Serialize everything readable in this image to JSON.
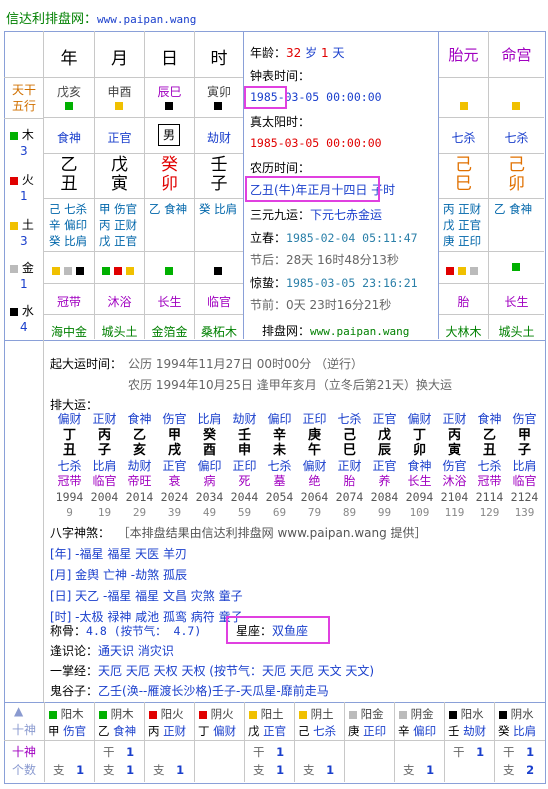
{
  "header": {
    "title": "信达利排盘网：",
    "url": "www.paipan.wang"
  },
  "pillars": {
    "labels": [
      "年",
      "月",
      "日",
      "时"
    ],
    "left_labels": {
      "stem": "天干",
      "element": "五行"
    },
    "nayin_short": [
      "戊亥",
      "申酉",
      "辰巳",
      "寅卯"
    ],
    "gods": [
      "食神",
      "正官",
      "男",
      "劫财"
    ],
    "stems": [
      "乙",
      "戊",
      "癸",
      "壬"
    ],
    "branches": [
      "丑",
      "寅",
      "卯",
      "子"
    ],
    "hidden": [
      [
        "己 七杀",
        "辛 偏印",
        "癸 比肩"
      ],
      [
        "甲 伤官",
        "丙 正财",
        "戊 正官"
      ],
      [
        "乙 食神"
      ],
      [
        "癸 比肩"
      ]
    ],
    "growth": [
      "冠带",
      "沐浴",
      "长生",
      "临官"
    ],
    "nayin": [
      "海中金",
      "城头土",
      "金箔金",
      "桑柘木"
    ]
  },
  "elements": [
    {
      "name": "木",
      "count": "3",
      "color": "#00b000"
    },
    {
      "name": "火",
      "count": "1",
      "color": "#e00000"
    },
    {
      "name": "土",
      "count": "3",
      "color": "#f0c000"
    },
    {
      "name": "金",
      "count": "1",
      "color": "#bbbbbb"
    },
    {
      "name": "水",
      "count": "4",
      "color": "#000000"
    }
  ],
  "info": {
    "age_label": "年龄：",
    "age_years": "32",
    "age_unit": "岁",
    "age_days": "1",
    "age_days_unit": "天",
    "clock_label": "钟表时间：",
    "clock_value": "1985-03-05 00:00:00",
    "solar_label": "真太阳时：",
    "solar_value": "1985-03-05 00:00:00",
    "lunar_label": "农历时间：",
    "lunar_value": "乙丑(牛)年正月十四日 子时",
    "yuan_label": "三元九运：",
    "yuan_value": "下元七赤金运",
    "lichun_label": "立春：",
    "lichun_value": "1985-02-04 05:11:47",
    "after_label": "节后：",
    "after_value": "28天 16时48分13秒",
    "jingzhe_label": "惊蛰：",
    "jingzhe_value": "1985-03-05 23:16:21",
    "before_label": "节前：",
    "before_value": "0天 23时16分21秒",
    "site_label": "排盘网：",
    "site_value": "www.paipan.wang"
  },
  "right_cols": {
    "labels": [
      "胎元",
      "命宫"
    ],
    "gods": [
      "七杀",
      "七杀"
    ],
    "stems": [
      "己",
      "己"
    ],
    "branches": [
      "巳",
      "卯"
    ],
    "hidden": [
      [
        "丙 正财",
        "戊 正官",
        "庚 正印"
      ],
      [
        "乙 食神"
      ]
    ],
    "growth": [
      "胎",
      "长生"
    ],
    "nayin": [
      "大林木",
      "城头土"
    ]
  },
  "luck": {
    "start_label": "起大运时间：",
    "start_solar": "公历 1994年11月27日 00时00分 （逆行）",
    "start_lunar": "农历 1994年10月25日 逢甲年亥月（立冬后第21天）换大运",
    "list_label": "排大运：",
    "gods": [
      "偏财",
      "正财",
      "食神",
      "伤官",
      "比肩",
      "劫财",
      "偏印",
      "正印",
      "七杀",
      "正官",
      "偏财",
      "正财",
      "食神",
      "伤官"
    ],
    "stems": [
      "丁",
      "丙",
      "乙",
      "甲",
      "癸",
      "壬",
      "辛",
      "庚",
      "己",
      "戊",
      "丁",
      "丙",
      "乙",
      "甲"
    ],
    "branches": [
      "丑",
      "子",
      "亥",
      "戌",
      "酉",
      "申",
      "未",
      "午",
      "巳",
      "辰",
      "卯",
      "寅",
      "丑",
      "子"
    ],
    "branch_gods": [
      "七杀",
      "比肩",
      "劫财",
      "正官",
      "偏印",
      "正印",
      "七杀",
      "偏财",
      "正财",
      "正官",
      "食神",
      "伤官",
      "七杀",
      "比肩"
    ],
    "growth": [
      "冠带",
      "临官",
      "帝旺",
      "衰",
      "病",
      "死",
      "墓",
      "绝",
      "胎",
      "养",
      "长生",
      "沐浴",
      "冠带",
      "临官"
    ],
    "years": [
      "1994",
      "2004",
      "2014",
      "2024",
      "2034",
      "2044",
      "2054",
      "2064",
      "2074",
      "2084",
      "2094",
      "2104",
      "2114",
      "2124"
    ],
    "ages": [
      "9",
      "19",
      "29",
      "39",
      "49",
      "59",
      "69",
      "79",
      "89",
      "99",
      "109",
      "119",
      "129",
      "139"
    ]
  },
  "shensha": {
    "label": "八字神煞：",
    "note": "［本排盘结果由信达利排盘网 www.paipan.wang 提供］",
    "rows": [
      "[年] -福星 福星 天医 羊刃",
      "[月] 金舆 亡神 -劫煞 孤辰",
      "[日] 天乙 -福星 福星 文昌 灾煞 童子",
      "[时] -太极 禄神 咸池 孤鸾 病符 童子"
    ]
  },
  "extra": {
    "bone_label": "称骨：",
    "bone_value": "4.8 (按节气： 4.7)",
    "star_label": "星座：",
    "star_value": "双鱼座",
    "dao_label": "逢识论：",
    "dao_value": "通天识 消灾识",
    "yizhang_label": "一掌经：",
    "yizhang_value": "天厄 天厄 天权 天权 (按节气：天厄 天厄 天文 天文)",
    "guigu_label": "鬼谷子：",
    "guigu_value": "乙壬(涣--雁渡长沙格)壬子-天瓜星-靡前走马"
  },
  "bottom": {
    "top_left": "十神",
    "row2_left": "十神",
    "row3_left": "个数",
    "cells": [
      {
        "sq": "#00b000",
        "yy": "阳木",
        "stem": "甲",
        "god": "伤官",
        "gan": "",
        "gan_n": "",
        "zhi": "支",
        "zhi_n": "1"
      },
      {
        "sq": "#00b000",
        "yy": "阴木",
        "stem": "乙",
        "god": "食神",
        "gan": "干",
        "gan_n": "1",
        "zhi": "支",
        "zhi_n": "1"
      },
      {
        "sq": "#e00000",
        "yy": "阳火",
        "stem": "丙",
        "god": "正财",
        "gan": "",
        "gan_n": "",
        "zhi": "支",
        "zhi_n": "1"
      },
      {
        "sq": "#e00000",
        "yy": "阴火",
        "stem": "丁",
        "god": "偏财",
        "gan": "",
        "gan_n": "",
        "zhi": "",
        "zhi_n": ""
      },
      {
        "sq": "#f0c000",
        "yy": "阳土",
        "stem": "戊",
        "god": "正官",
        "gan": "干",
        "gan_n": "1",
        "zhi": "支",
        "zhi_n": "1"
      },
      {
        "sq": "#f0c000",
        "yy": "阴土",
        "stem": "己",
        "god": "七杀",
        "gan": "",
        "gan_n": "",
        "zhi": "支",
        "zhi_n": "1"
      },
      {
        "sq": "#bbbbbb",
        "yy": "阳金",
        "stem": "庚",
        "god": "正印",
        "gan": "",
        "gan_n": "",
        "zhi": "",
        "zhi_n": ""
      },
      {
        "sq": "#bbbbbb",
        "yy": "阴金",
        "stem": "辛",
        "god": "偏印",
        "gan": "",
        "gan_n": "",
        "zhi": "支",
        "zhi_n": "1"
      },
      {
        "sq": "#000000",
        "yy": "阳水",
        "stem": "壬",
        "god": "劫财",
        "gan": "干",
        "gan_n": "1",
        "zhi": "",
        "zhi_n": ""
      },
      {
        "sq": "#000000",
        "yy": "阴水",
        "stem": "癸",
        "god": "比肩",
        "gan": "干",
        "gan_n": "1",
        "zhi": "支",
        "zhi_n": "2"
      }
    ]
  }
}
